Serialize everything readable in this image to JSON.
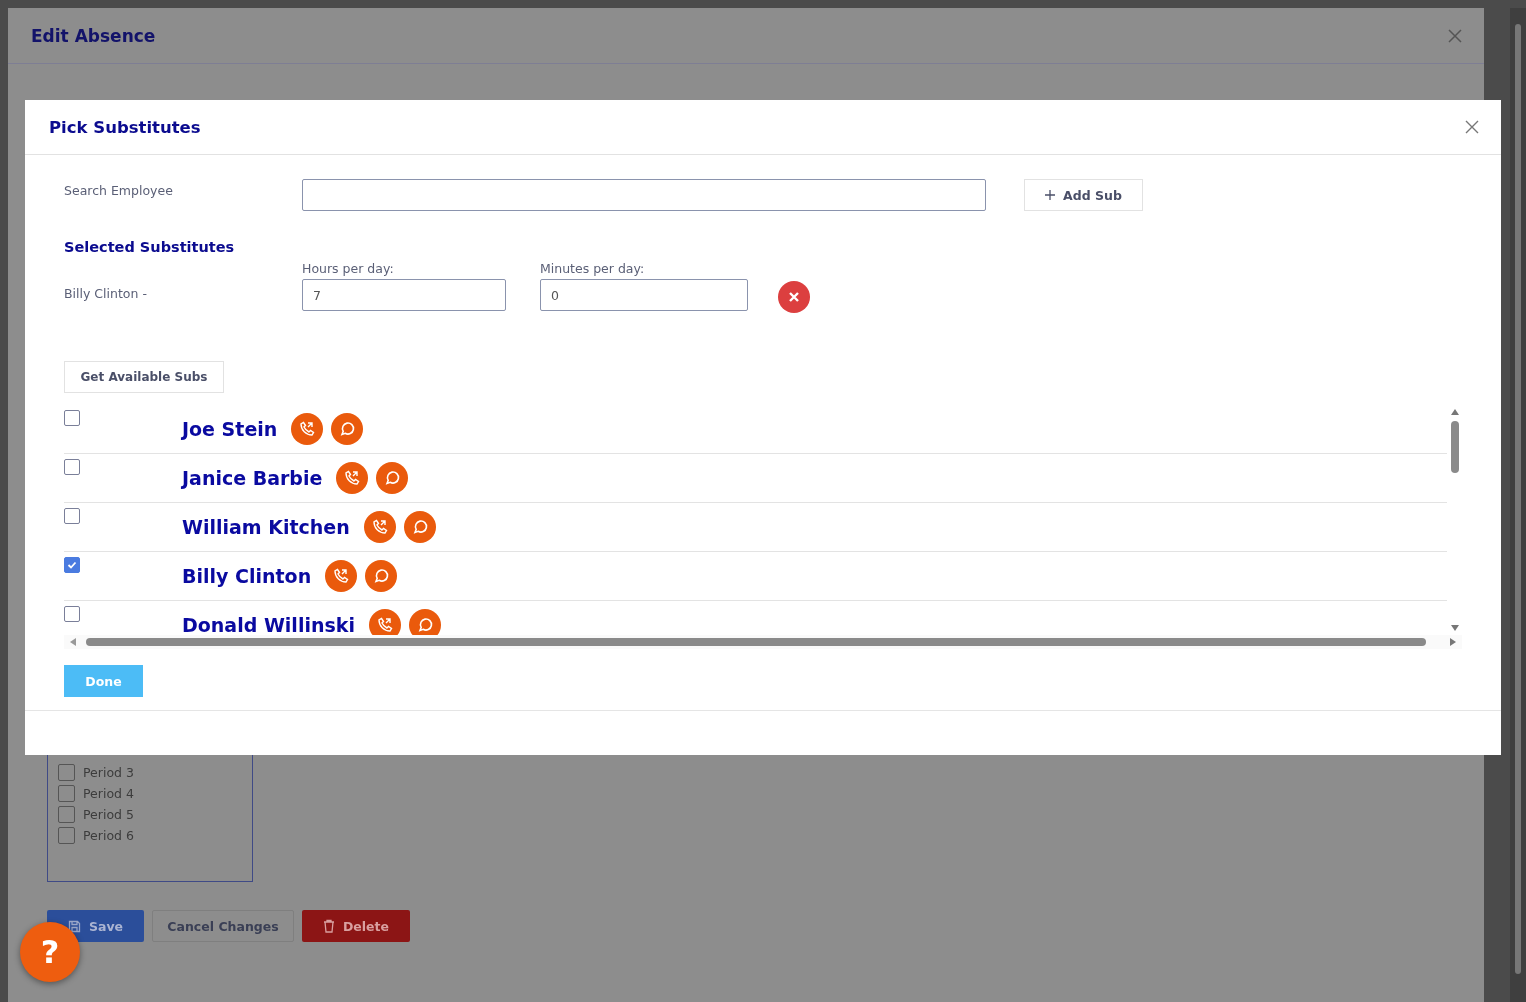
{
  "background_dialog": {
    "title": "Edit Absence",
    "periods": [
      {
        "label": "Period 3",
        "checked": false
      },
      {
        "label": "Period 4",
        "checked": false
      },
      {
        "label": "Period 5",
        "checked": false
      },
      {
        "label": "Period 6",
        "checked": false
      }
    ],
    "buttons": [
      {
        "label": "Save",
        "kind": "primary"
      },
      {
        "label": "Cancel Changes",
        "kind": "secondary"
      },
      {
        "label": "Delete",
        "kind": "danger"
      }
    ],
    "help_button": "?"
  },
  "dialog": {
    "title": "Pick Substitutes",
    "search": {
      "label": "Search Employee"
    },
    "add_button": "Add Sub",
    "selected_heading": "Selected Substitutes",
    "selected": [
      {
        "name": "Billy Clinton -",
        "hours_label": "Hours per day:",
        "hours": "7",
        "minutes_label": "Minutes per day:",
        "minutes": "0"
      }
    ],
    "get_button": "Get Available Subs",
    "substitutes": [
      {
        "name": "Joe Stein",
        "checked": false
      },
      {
        "name": "Janice Barbie",
        "checked": false
      },
      {
        "name": "William Kitchen",
        "checked": false
      },
      {
        "name": "Billy Clinton",
        "checked": true
      },
      {
        "name": "Donald Willinski",
        "checked": false
      }
    ],
    "done_button": "Done"
  }
}
